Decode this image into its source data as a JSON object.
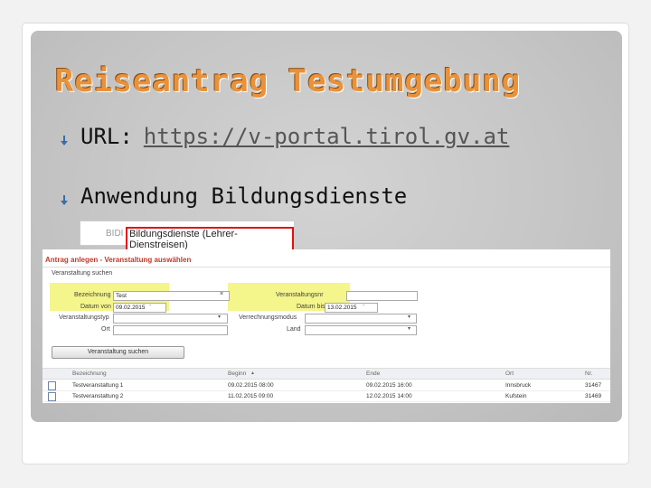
{
  "slide": {
    "title": "Reiseantrag Testumgebung",
    "bullets": [
      {
        "label": "URL:",
        "link": "https://v-portal.tirol.gv.at"
      },
      {
        "label": "Anwendung Bildungsdienste"
      }
    ]
  },
  "snippet1": {
    "prefix": "BIDI",
    "selected": "Bildungsdienste (Lehrer-Dienstreisen)",
    "highlight_color": "#e31010"
  },
  "form": {
    "heading": "Antrag anlegen - Veranstaltung auswählen",
    "section": "Veranstaltung suchen",
    "fields": {
      "bezeichnung_label": "Bezeichnung",
      "bezeichnung_value": "Test",
      "datum_von_label": "Datum von",
      "datum_von_value": "09.02.2015",
      "veranstaltungstyp_label": "Veranstaltungstyp",
      "ort_label": "Ort",
      "veranstaltungsnr_label": "Veranstaltungsnr",
      "datum_bis_label": "Datum bis",
      "datum_bis_value": "13.02.2015",
      "verrechnungsmodus_label": "Verrechnungsmodus",
      "land_label": "Land"
    },
    "search_button": "Veranstaltung suchen",
    "highlight_color": "#f4f58a"
  },
  "table": {
    "columns": [
      "Bezeichnung",
      "Beginn",
      "Ende",
      "Ort",
      "Nr."
    ],
    "rows": [
      [
        "Testveranstaltung 1",
        "09.02.2015 08:00",
        "09.02.2015 16:00",
        "Innsbruck",
        "31467"
      ],
      [
        "Testveranstaltung 2",
        "11.02.2015 09:00",
        "12.02.2015 14:00",
        "Kufstein",
        "31469"
      ]
    ]
  }
}
